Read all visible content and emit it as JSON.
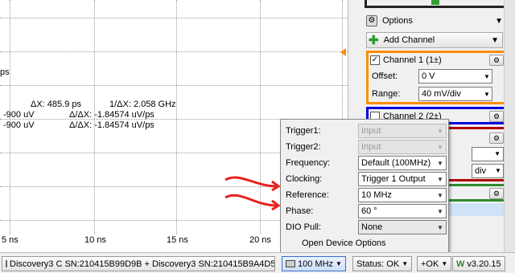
{
  "plot": {
    "x_ticks": [
      "5 ns",
      "10 ns",
      "15 ns",
      "20 ns"
    ],
    "unit_fragment": "ps",
    "measurements": {
      "dx": "ΔX: 485.9 ps",
      "inv_dx": "1/ΔX: 2.058 GHz",
      "row1_left": "-900 uV",
      "row1_right": "Δ/ΔX: -1.84574 uV/ps",
      "row2_left": "-900 uV",
      "row2_right": "Δ/ΔX: -1.84574 uV/ps"
    },
    "trigger_color": "#ff8c00"
  },
  "panel": {
    "options_label": "Options",
    "add_channel_label": "Add Channel",
    "channel1": {
      "title": "Channel 1 (1±)",
      "checked": "✓",
      "color": "#ff8c00",
      "offset_label": "Offset:",
      "offset_value": "0 V",
      "range_label": "Range:",
      "range_value": "40 mV/div"
    },
    "channel2": {
      "title": "Channel 2 (2±)",
      "color": "#0000e0"
    },
    "ch3_fragment": "div",
    "red_color": "#b00000",
    "green_color": "#2e8b2e"
  },
  "popup": {
    "rows": [
      {
        "label": "Trigger1:",
        "value": "Input"
      },
      {
        "label": "Trigger2:",
        "value": "Input"
      },
      {
        "label": "Frequency:",
        "value": "Default (100MHz)"
      },
      {
        "label": "Clocking:",
        "value": "Trigger 1 Output"
      },
      {
        "label": "Reference:",
        "value": "10 MHz"
      },
      {
        "label": "Phase:",
        "value": "60 °"
      },
      {
        "label": "DIO Pull:",
        "value": "None"
      }
    ],
    "open_device_options": "Open Device Options"
  },
  "statusbar": {
    "device": "Discovery3 C SN:210415B99D9B + Discovery3 SN:210415B9A4D5",
    "clock": "100 MHz",
    "status": "Status: OK",
    "ok": "+OK",
    "version": "v3.20.15"
  },
  "annotation_color": "#e8201e"
}
